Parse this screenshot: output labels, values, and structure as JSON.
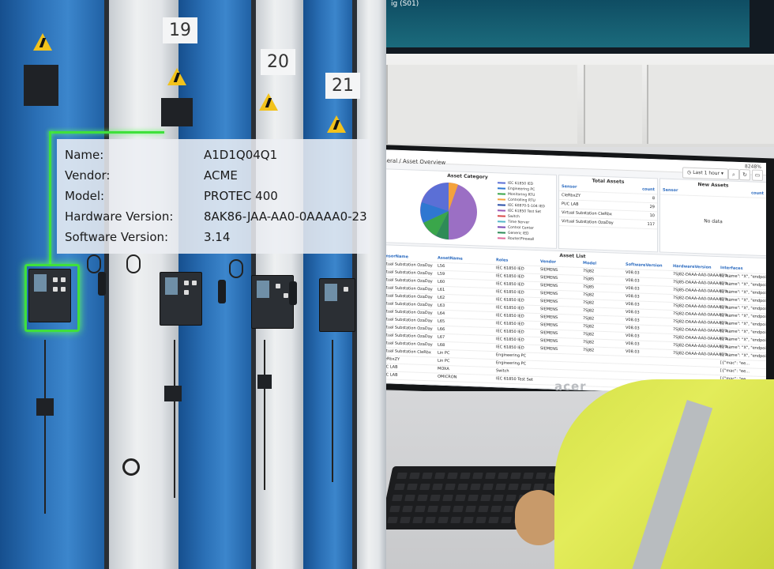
{
  "info_panel": {
    "rows": [
      {
        "label": "Name:",
        "value": "A1D1Q04Q1"
      },
      {
        "label": "Vendor:",
        "value": "ACME"
      },
      {
        "label": "Model:",
        "value": "PROTEC 400"
      },
      {
        "label": "Hardware Version:",
        "value": "8AK86-JAA-AA0-0AAAA0-23"
      },
      {
        "label": "Software Version:",
        "value": "3.14"
      }
    ]
  },
  "cabinet_numbers": [
    "19",
    "20",
    "21"
  ],
  "colors": {
    "highlight": "#3fe03b",
    "cabinet_blue": "#2a6fb5",
    "vest": "#dfe852"
  },
  "top_screen_text": "ig (S01)",
  "monitor_brand": "acer",
  "dashboard": {
    "hostname": "8248%",
    "breadcrumb": "eneral / Asset Overview",
    "time_range": "Last 1 hour",
    "asset_category": {
      "title": "Asset Category",
      "legend": [
        "IEC 61850 IED",
        "Engineering PC",
        "Monitoring RTU",
        "Controlling RTU",
        "IEC 60870-5-104 IED",
        "IEC 61850 Test Set",
        "Switch",
        "Time Server",
        "Control Center",
        "Generic IED",
        "Router/Firewall"
      ],
      "legend_colors": [
        "#5b6fd6",
        "#2f77d1",
        "#3aa64a",
        "#f4a23c",
        "#2b4fa8",
        "#9b59b6",
        "#d94a4a",
        "#55b8c9",
        "#7a4bb5",
        "#2e8b57",
        "#e06a9a"
      ]
    },
    "total_assets": {
      "title": "Total Assets",
      "col_sensor": "Sensor",
      "col_count": "count",
      "rows": [
        {
          "sensor": "CleRbxZY",
          "count": "8"
        },
        {
          "sensor": "PUC LAB",
          "count": "29"
        },
        {
          "sensor": "Virtual Substation CleRbx",
          "count": "10"
        },
        {
          "sensor": "Virtual Substation OzaDay",
          "count": "117"
        }
      ]
    },
    "new_assets": {
      "title": "New Assets",
      "col_sensor": "Sensor",
      "col_count": "count",
      "empty": "No data"
    },
    "asset_list": {
      "title": "Asset List",
      "headers": [
        "sensorName",
        "AssetName",
        "Roles",
        "Vendor",
        "Model",
        "SoftwareVersion",
        "HardwareVersion",
        "Interfaces"
      ],
      "rows": [
        [
          "Virtual Substation OzaDay",
          "L56",
          "IEC 61850 IED",
          "SIEMENS",
          "7SJ82",
          "V08.03",
          "7SJ82-DAAA-AA0-0AAAA0-A...",
          "[{\"name\": \"X\", \"endpoi..."
        ],
        [
          "Virtual Substation OzaDay",
          "L59",
          "IEC 61850 IED",
          "SIEMENS",
          "7SJ85",
          "V08.03",
          "7SJ85-DAAA-AA0-0AAAA0-A...",
          "[{\"name\": \"X\", \"endpoi..."
        ],
        [
          "Virtual Substation OzaDay",
          "L60",
          "IEC 61850 IED",
          "SIEMENS",
          "7SJ85",
          "V08.03",
          "7SJ85-DAAA-AA0-0AAAA0-A...",
          "[{\"name\": \"X\", \"endpoi..."
        ],
        [
          "Virtual Substation OzaDay",
          "L61",
          "IEC 61850 IED",
          "SIEMENS",
          "7SJ82",
          "V08.03",
          "7SJ82-DAAA-AA0-0AAAA0-A...",
          "[{\"name\": \"X\", \"endpoi..."
        ],
        [
          "Virtual Substation OzaDay",
          "L62",
          "IEC 61850 IED",
          "SIEMENS",
          "7SJ82",
          "V08.03",
          "7SJ82-DAAA-AA0-0AAAA0-A...",
          "[{\"name\": \"X\", \"endpoi..."
        ],
        [
          "Virtual Substation OzaDay",
          "L63",
          "IEC 61850 IED",
          "SIEMENS",
          "7SJ82",
          "V08.03",
          "7SJ82-DAAA-AA0-0AAAA0-A...",
          "[{\"name\": \"X\", \"endpoi..."
        ],
        [
          "Virtual Substation OzaDay",
          "L64",
          "IEC 61850 IED",
          "SIEMENS",
          "7SJ82",
          "V08.03",
          "7SJ82-DAAA-AA0-0AAAA0-A...",
          "[{\"name\": \"X\", \"endpoi..."
        ],
        [
          "Virtual Substation OzaDay",
          "L65",
          "IEC 61850 IED",
          "SIEMENS",
          "7SJ82",
          "V08.03",
          "7SJ82-DAAA-AA0-0AAAA0-A...",
          "[{\"name\": \"X\", \"endpoi..."
        ],
        [
          "Virtual Substation OzaDay",
          "L66",
          "IEC 61850 IED",
          "SIEMENS",
          "7SJ82",
          "V08.03",
          "7SJ82-DAAA-AA0-0AAAA0-A...",
          "[{\"name\": \"X\", \"endpoi..."
        ],
        [
          "Virtual Substation OzaDay",
          "L67",
          "IEC 61850 IED",
          "SIEMENS",
          "7SJ82",
          "V08.03",
          "7SJ82-DAAA-AA0-0AAAA0-A...",
          "[{\"name\": \"X\", \"endpoi..."
        ],
        [
          "Virtual Substation OzaDay",
          "L68",
          "IEC 61850 IED",
          "SIEMENS",
          "7SJ82",
          "V08.03",
          "7SJ82-DAAA-AA0-0AAAA0-A...",
          "[{\"name\": \"X\", \"endpoi..."
        ],
        [
          "Virtual Substation CleRbx",
          "Lin PC",
          "Engineering PC",
          "",
          "",
          "",
          "",
          "[{\"mac\": \"ee..."
        ],
        [
          "CleRbxZY",
          "Lin PC",
          "Engineering PC",
          "",
          "",
          "",
          "",
          "[{\"mac\": \"ee..."
        ],
        [
          "PUC LAB",
          "MOXA",
          "Switch",
          "",
          "",
          "",
          "",
          "[{\"mac\": \"ee..."
        ],
        [
          "PUC LAB",
          "OMICRON",
          "IEC 61850 Test Set",
          "",
          "",
          "",
          "",
          "[{\"mac\": \"ee..."
        ]
      ]
    }
  }
}
